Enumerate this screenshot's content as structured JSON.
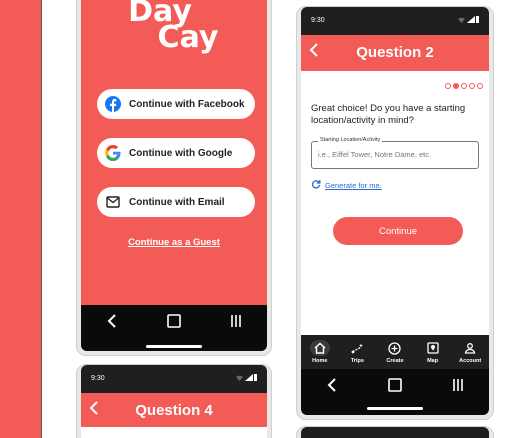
{
  "colors": {
    "brand": "#f35b57",
    "dark": "#1f1f1f",
    "link": "#2c6bd6"
  },
  "login": {
    "logo_line1": "Day",
    "logo_line2": "Cay",
    "facebook_label": "Continue with Facebook",
    "google_label": "Continue with Google",
    "email_label": "Continue with Email",
    "guest_label": "Continue as a Guest"
  },
  "question2": {
    "time": "9:30",
    "header_title": "Question 2",
    "question": "Great choice! Do you have a starting location/activity in mind?",
    "field_label": "Starting Location/Activity",
    "field_placeholder": "i.e., Eiffel Tower, Notre Dame, etc.",
    "generate_label": "Generate for me.",
    "continue_label": "Continue",
    "progress_dots": 5,
    "active_dot": 2,
    "tabs": [
      {
        "label": "Home",
        "icon": "home-icon"
      },
      {
        "label": "Trips",
        "icon": "route-icon"
      },
      {
        "label": "Create",
        "icon": "plus-circle-icon"
      },
      {
        "label": "Map",
        "icon": "map-icon"
      },
      {
        "label": "Account",
        "icon": "account-icon"
      }
    ]
  },
  "question4": {
    "time": "9:30",
    "header_title": "Question 4"
  }
}
